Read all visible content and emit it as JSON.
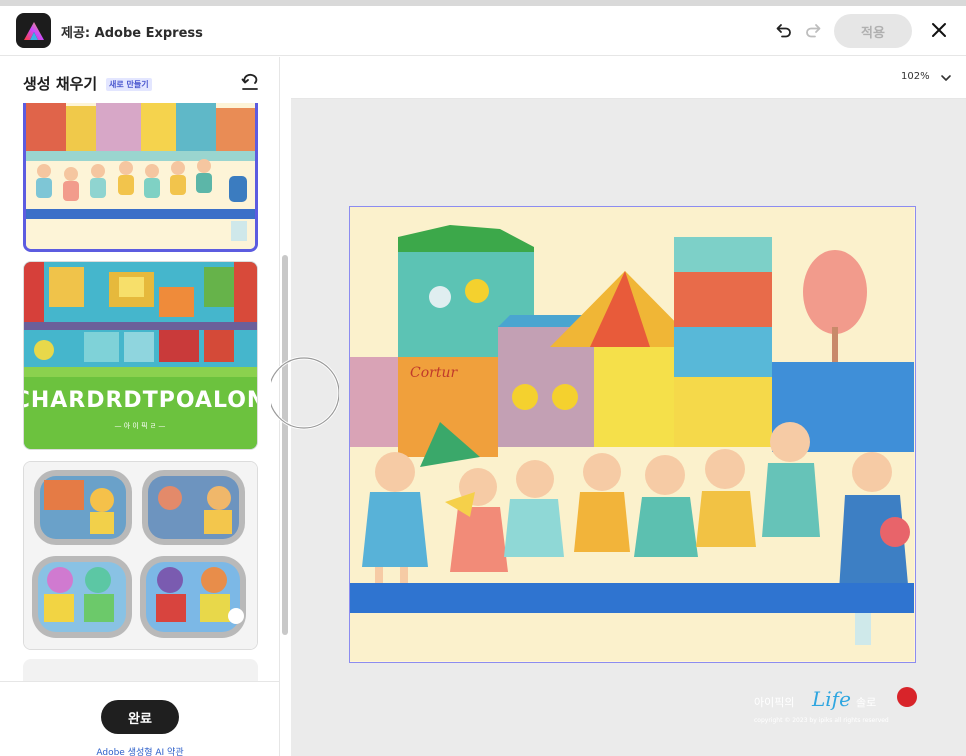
{
  "header": {
    "title": "제공: Adobe Express",
    "apply_label": "적용"
  },
  "panel": {
    "title": "생성 채우기",
    "badge": "새로 만들기",
    "done_label": "완료",
    "terms_link": "Adobe 생성형 AI 약관"
  },
  "thumbnails": [
    {
      "state": "selected"
    },
    {
      "caption_art": "CHARDRDTPOALON",
      "caption_small": "— 아 이 픽 ㄹ —"
    },
    {
      "state": "default"
    }
  ],
  "canvas": {
    "zoom": "102%"
  },
  "watermark": {
    "korean": "아이픽의",
    "life": "Life",
    "suffix": "솔로",
    "copyright": "copyright © 2023 by ipiks all rights reserved"
  },
  "colors": {
    "accent": "#5c5ce0",
    "selection": "#8c8cf0",
    "link": "#2b5ec9",
    "done_button": "#1f1f1f"
  },
  "icons": [
    "adobe-express-logo-icon",
    "undo-icon",
    "redo-icon",
    "close-icon",
    "panel-undo-icon",
    "chevron-down-icon"
  ]
}
